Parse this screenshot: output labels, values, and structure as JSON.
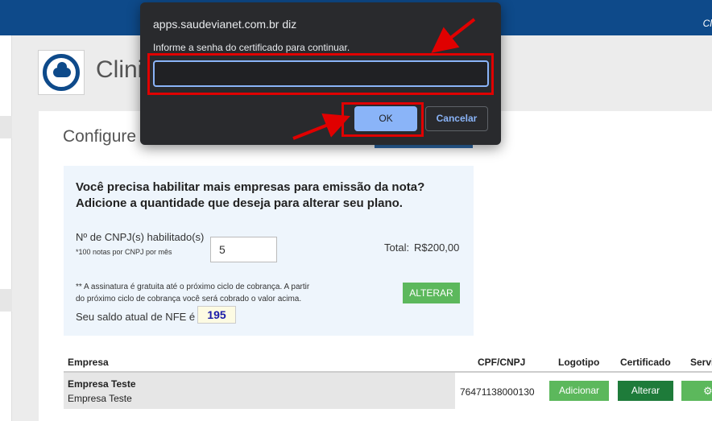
{
  "browser_prompt": {
    "origin": "apps.saudevianet.com.br diz",
    "message": "Informe a senha do certificado para continuar.",
    "input_value": "",
    "ok_label": "OK",
    "cancel_label": "Cancelar"
  },
  "header": {
    "right_text": "Cl"
  },
  "brand": {
    "name": "Clinic"
  },
  "page": {
    "title": "Configure"
  },
  "plan_box": {
    "heading_line1": "Você precisa habilitar mais empresas para emissão da nota?",
    "heading_line2": "Adicione a quantidade que deseja para alterar seu plano.",
    "cnpj_label": "Nº de CNPJ(s) habilitado(s)",
    "cnpj_sub": "*100 notas por CNPJ por mês",
    "cnpj_value": "5",
    "total_label": "Total:",
    "total_value": "R$200,00",
    "note_line1": "** A assinatura é gratuita até o próximo ciclo de cobrança. A partir",
    "note_line2": "do próximo ciclo de cobrança você será cobrado o valor acima.",
    "alterar_label": "ALTERAR",
    "saldo_label": "Seu saldo atual de NFE é",
    "saldo_value": "195"
  },
  "table": {
    "headers": [
      "Empresa",
      "CPF/CNPJ",
      "Logotipo",
      "Certificado",
      "Servi"
    ],
    "rows": [
      {
        "company_bold": "Empresa Teste",
        "company_plain": "Empresa Teste",
        "cnpj": "76471138000130",
        "logo_btn": "Adicionar",
        "cert_btn": "Alterar",
        "serv_icon": "gear-icon"
      }
    ]
  },
  "colors": {
    "topbar": "#0e4a8a",
    "dialog_bg": "#292a2d",
    "dialog_accent": "#8ab4f8",
    "highlight": "#e00000",
    "green": "#5cb85c",
    "dark_green": "#1e7b3a"
  }
}
